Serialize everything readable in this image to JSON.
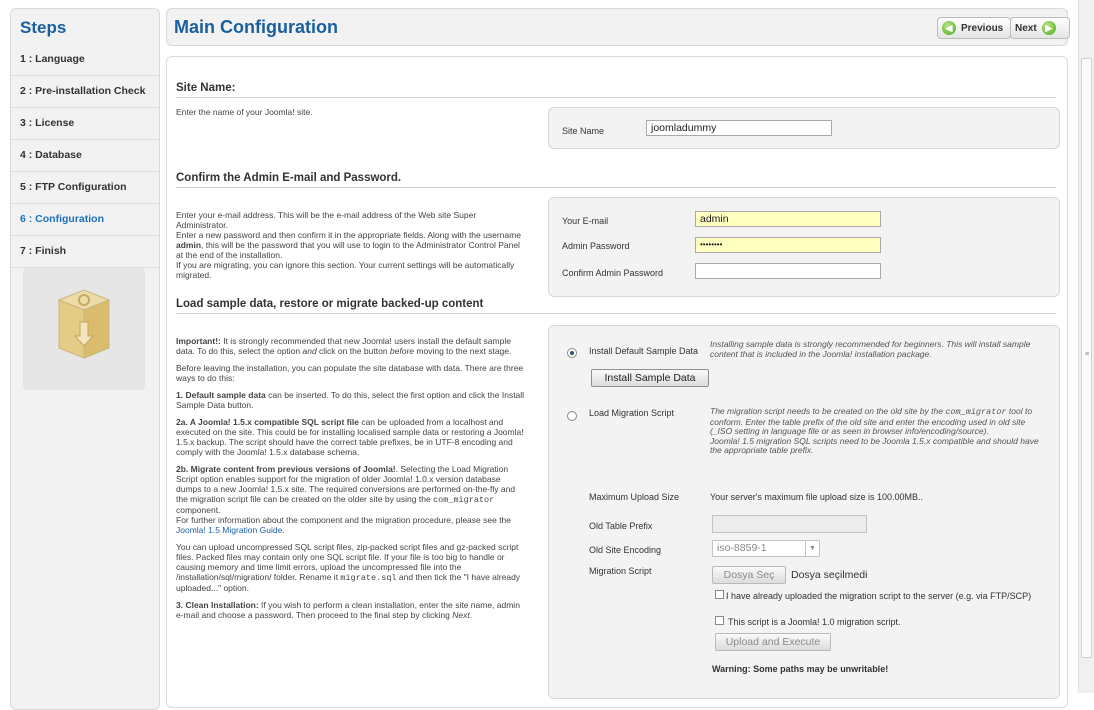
{
  "sidebar": {
    "title": "Steps",
    "items": [
      {
        "label": "1 : Language"
      },
      {
        "label": "2 : Pre-installation Check"
      },
      {
        "label": "3 : License"
      },
      {
        "label": "4 : Database"
      },
      {
        "label": "5 : FTP Configuration"
      },
      {
        "label": "6 : Configuration",
        "active": true
      },
      {
        "label": "7 : Finish"
      }
    ]
  },
  "header": {
    "title": "Main Configuration",
    "previous_label": "Previous",
    "next_label": "Next"
  },
  "site_name_section": {
    "title": "Site Name:",
    "description": "Enter the name of your Joomla! site.",
    "field_label": "Site Name",
    "field_value": "joomladummy"
  },
  "admin_section": {
    "title": "Confirm the Admin E-mail and Password.",
    "desc_1": "Enter your e-mail address. This will be the e-mail address of the Web site Super Administrator.",
    "desc_2a": "Enter a new password and then confirm it in the appropriate fields. Along with the username ",
    "desc_2b": "admin",
    "desc_2c": ", this will be the password that you will use to login to the Administrator Control Panel at the end of the installation.",
    "desc_3": "If you are migrating, you can ignore this section. Your current settings will be automatically migrated.",
    "email_label": "Your E-mail",
    "email_value": "admin",
    "password_label": "Admin Password",
    "password_value": "••••••••",
    "confirm_label": "Confirm Admin Password",
    "confirm_value": ""
  },
  "sample_section": {
    "title": "Load sample data, restore or migrate backed-up content",
    "p1_bold": "Important!:",
    "p1_a": " It is strongly recommended that new Joomla! users install the default sample data. To do this, select the option ",
    "p1_and": "and",
    "p1_b": " click on the button ",
    "p1_before": "before",
    "p1_c": " moving to the next stage.",
    "p2": "Before leaving the installation, you can populate the site database with data. There are three ways to do this:",
    "p3_bold": "1. Default sample data",
    "p3": " can be inserted. To do this, select the first option and click the Install Sample Data button.",
    "p4_bold": "2a. A Joomla! 1.5.x compatible SQL script file",
    "p4": " can be uploaded from a localhost and executed on the site. This could be for installing localised sample data or restoring a Joomla! 1.5.x backup. The script should have the correct table prefixes, be in UTF-8 encoding and comply with the Joomla! 1.5.x database schema.",
    "p5_bold": "2b. Migrate content from previous versions of Joomla!",
    "p5_a": ". Selecting the Load Migration Script option enables support for the migration of older Joomla! 1.0.x version database dumps to a new Joomla! 1.5.x site. The required conversions are performed on-the-fly and the migration script file can be created on the older site by using the ",
    "p5_code": "com_migrator",
    "p5_b": " component.",
    "p5_c": "For further information about the component and the migration procedure, please see the ",
    "p5_link": "Joomla! 1.5 Migration Guide",
    "p5_d": ".",
    "p6_a": "You can upload uncompressed SQL script files, zip-packed script files and gz-packed script files. Packed files may contain only one SQL script file. If your file is too big to handle or causing memory and time limit errors, upload the uncompressed file into the /installation/sql/migration/ folder. Rename it ",
    "p6_code": "migrate.sql",
    "p6_b": " and then tick the \"I have already uploaded...\" option.",
    "p7_bold": "3. Clean Installation:",
    "p7_a": " If you wish to perform a clean installation, enter the site name, admin e-mail and choose a password. Then proceed to the final step by clicking ",
    "p7_next": "Next",
    "p7_b": ".",
    "opt1_label": "Install Default Sample Data",
    "opt1_help": "Installing sample data is strongly recommended for beginners. This will install sample content that is included in the Joomla! installation package.",
    "install_btn": "Install Sample Data",
    "opt2_label": "Load Migration Script",
    "opt2_help_a": "The migration script needs to be created on the old site by the ",
    "opt2_help_code": "com_migrator",
    "opt2_help_b": " tool to conform. Enter the table prefix of the old site and enter the encoding used in old site (_ISO setting in language file or as seen in browser info/encoding/source).",
    "opt2_help_c": "Joomla! 1.5 migration SQL scripts need to be Joomla 1.5.x compatible and should have the appropriate table prefix.",
    "max_upload_label": "Maximum Upload Size",
    "max_upload_value": "Your server's maximum file upload size is 100.00MB..",
    "old_prefix_label": "Old Table Prefix",
    "old_prefix_value": "",
    "old_encoding_label": "Old Site Encoding",
    "old_encoding_value": "iso-8859-1",
    "migration_script_label": "Migration Script",
    "choose_file_btn": "Dosya Seç",
    "no_file_text": "Dosya seçilmedi",
    "chk1_label": "I have already uploaded the migration script to the server (e.g. via FTP/SCP)",
    "chk2_label": "This script is a Joomla! 1.0 migration script.",
    "upload_btn": "Upload and Execute",
    "warning": "Warning: Some paths may be unwritable!"
  }
}
